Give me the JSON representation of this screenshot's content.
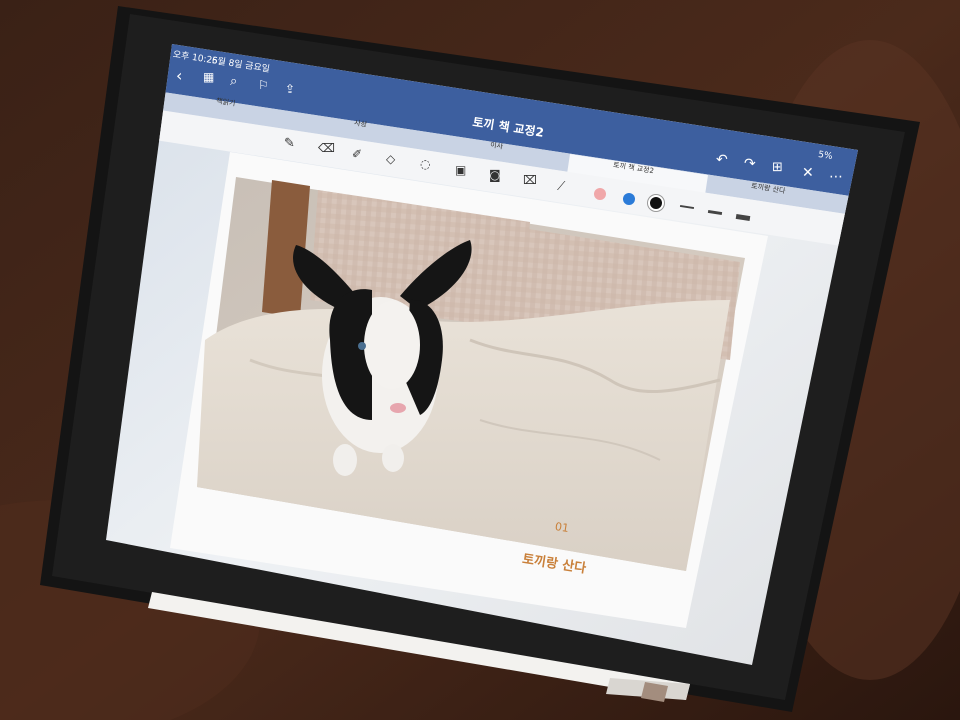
{
  "status_bar": {
    "time": "오후 10:25",
    "date": "6월 8일 금요일",
    "battery": "5%"
  },
  "nav": {
    "doc_title": "토끼 책 교정2"
  },
  "tabs": [
    {
      "label": "책읽기"
    },
    {
      "label": "사상"
    },
    {
      "label": "이사"
    },
    {
      "label": "토끼 책 교정2",
      "active": true
    },
    {
      "label": "토끼랑 산다"
    }
  ],
  "page": {
    "page_number": "01",
    "caption": "토끼랑 산다"
  },
  "colors": {
    "header_blue": "#3d5f9f",
    "tab_bar": "#c9d3e4",
    "accent_orange": "#c9803a",
    "pen_pink": "#f0a7a9",
    "pen_blue": "#2b7bd8",
    "pen_black": "#111111"
  },
  "icons": [
    "back-icon",
    "grid-icon",
    "search-icon",
    "bookmark-icon",
    "share-icon",
    "undo-icon",
    "redo-icon",
    "add-page-icon",
    "close-icon",
    "more-icon",
    "pen-icon",
    "eraser-icon",
    "highlighter-icon",
    "shapes-icon",
    "lasso-icon",
    "image-icon",
    "camera-icon",
    "text-box-icon",
    "laser-pointer-icon"
  ]
}
